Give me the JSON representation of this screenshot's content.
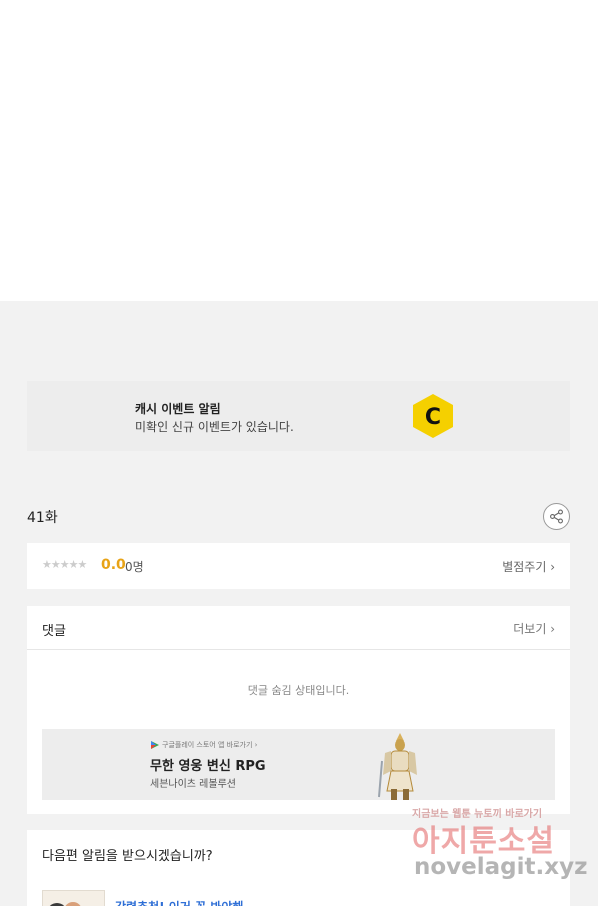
{
  "top": {
    "cut_text": ""
  },
  "banner": {
    "title": "캐시 이벤트 알림",
    "subtitle": "미확인 신규 이벤트가 있습니다.",
    "logo_letter": "C",
    "logo_color": "#f5d000"
  },
  "episode": {
    "title": "41화",
    "share_icon": "share-icon"
  },
  "rating": {
    "stars": "★★★★★",
    "score": "0.0",
    "count": "0명",
    "rate_link": "별점주기 ›"
  },
  "comments": {
    "title": "댓글",
    "more_link": "더보기 ›",
    "hidden_message": "댓글 숨김 상태입니다."
  },
  "ad": {
    "store_text": "구글플레이 스토어 앱 바로가기 ›",
    "title": "무한 영웅 변신 RPG",
    "subtitle": "세븐나이츠 레볼루션"
  },
  "next_alert": {
    "title": "다음편 알림을 받으시겠습니까?",
    "link": "강력추천! 이거 꼭 봐야해"
  },
  "watermark": {
    "small": "지금보는 웹툰 뉴토끼 바로가기",
    "big": "아지툰소설",
    "url": "novelagit.xyz"
  },
  "colors": {
    "accent_score": "#e8a316",
    "link_blue": "#2f6fd6",
    "page_bg": "#f2f2f2"
  }
}
